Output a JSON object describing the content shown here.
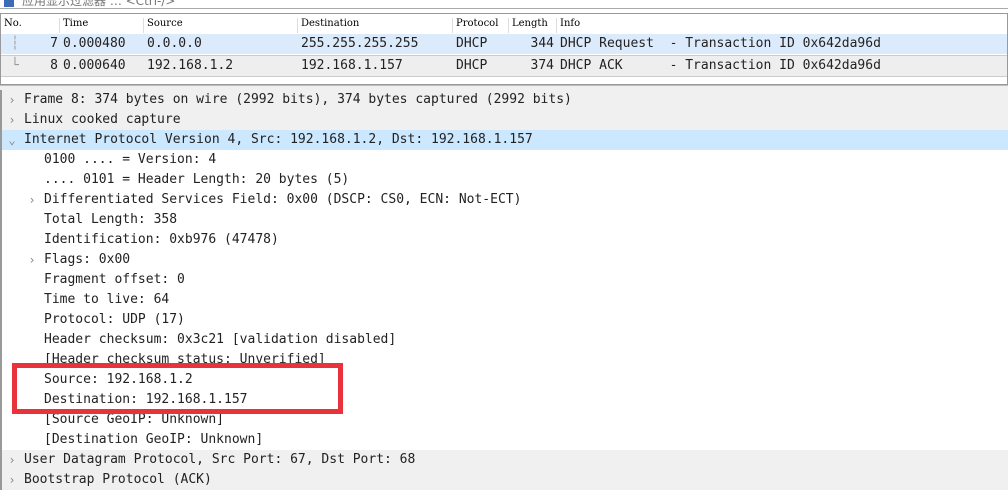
{
  "filter": {
    "placeholder": "应用显示过滤器 … <Ctrl-/>",
    "icon": "bookmark-icon"
  },
  "packet_list": {
    "columns": [
      "No.",
      "Time",
      "Source",
      "Destination",
      "Protocol",
      "Length",
      "Info"
    ],
    "rows": [
      {
        "no": "7",
        "time": "0.000480",
        "source": "0.0.0.0",
        "destination": "255.255.255.255",
        "protocol": "DHCP",
        "length": "344",
        "info": "DHCP Request  - Transaction ID 0x642da96d"
      },
      {
        "no": "8",
        "time": "0.000640",
        "source": "192.168.1.2",
        "destination": "192.168.1.157",
        "protocol": "DHCP",
        "length": "374",
        "info": "DHCP ACK      - Transaction ID 0x642da96d"
      }
    ]
  },
  "details": [
    {
      "text": "Frame 8: 374 bytes on wire (2992 bits), 374 bytes captured (2992 bits)",
      "level": 0,
      "arrow": "collapsed"
    },
    {
      "text": "Linux cooked capture",
      "level": 0,
      "arrow": "collapsed"
    },
    {
      "text": "Internet Protocol Version 4, Src: 192.168.1.2, Dst: 192.168.1.157",
      "level": 0,
      "arrow": "expanded",
      "selected": true
    },
    {
      "text": "0100 .... = Version: 4",
      "level": 1
    },
    {
      "text": ".... 0101 = Header Length: 20 bytes (5)",
      "level": 1
    },
    {
      "text": "Differentiated Services Field: 0x00 (DSCP: CS0, ECN: Not-ECT)",
      "level": 1,
      "arrow": "collapsed"
    },
    {
      "text": "Total Length: 358",
      "level": 1
    },
    {
      "text": "Identification: 0xb976 (47478)",
      "level": 1
    },
    {
      "text": "Flags: 0x00",
      "level": 1,
      "arrow": "collapsed"
    },
    {
      "text": "Fragment offset: 0",
      "level": 1
    },
    {
      "text": "Time to live: 64",
      "level": 1
    },
    {
      "text": "Protocol: UDP (17)",
      "level": 1
    },
    {
      "text": "Header checksum: 0x3c21 [validation disabled]",
      "level": 1
    },
    {
      "text": "[Header checksum status: Unverified]",
      "level": 1
    },
    {
      "text": "Source: 192.168.1.2",
      "level": 1
    },
    {
      "text": "Destination: 192.168.1.157",
      "level": 1
    },
    {
      "text": "[Source GeoIP: Unknown]",
      "level": 1
    },
    {
      "text": "[Destination GeoIP: Unknown]",
      "level": 1
    },
    {
      "text": "User Datagram Protocol, Src Port: 67, Dst Port: 68",
      "level": 0,
      "arrow": "collapsed"
    },
    {
      "text": "Bootstrap Protocol (ACK)",
      "level": 0,
      "arrow": "collapsed"
    }
  ],
  "highlight_color": "#e8333c"
}
